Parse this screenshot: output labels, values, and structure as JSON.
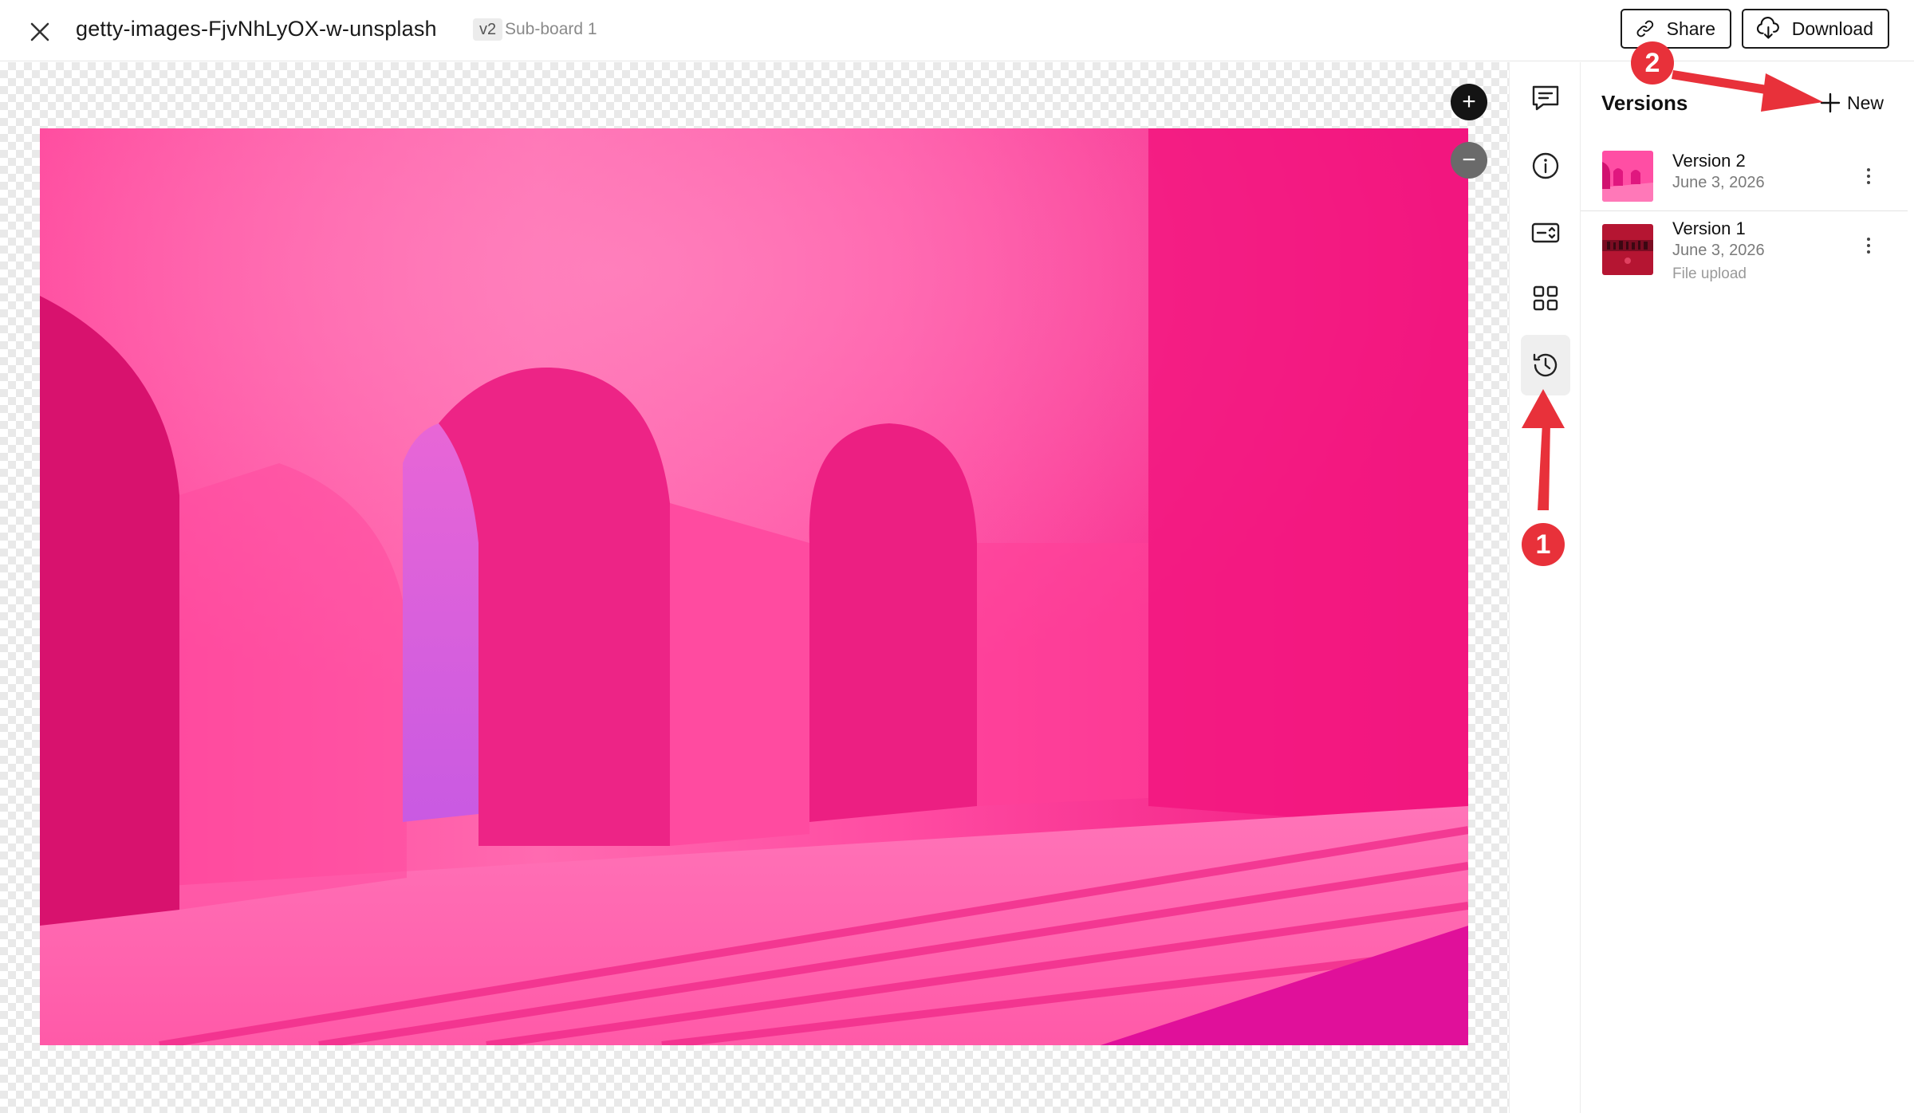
{
  "header": {
    "file_name": "getty-images-FjvNhLyOX-w-unsplash",
    "version_tag": "v2",
    "board_name": "Sub-board 1",
    "share_label": "Share",
    "download_label": "Download"
  },
  "canvas": {
    "zoom_in_label": "+",
    "zoom_out_label": "−"
  },
  "rail": {
    "items": [
      "comments",
      "info",
      "fields",
      "grid",
      "version-history"
    ],
    "active_item": "version-history"
  },
  "versions_panel": {
    "title": "Versions",
    "new_label": "New",
    "items": [
      {
        "name": "Version 2",
        "date": "June 3, 2026",
        "note": ""
      },
      {
        "name": "Version 1",
        "date": "June 3, 2026",
        "note": "File upload"
      }
    ]
  },
  "annotations": {
    "step1": "1",
    "step2": "2",
    "color": "#e8313a"
  },
  "colors": {
    "accent_pink": "#ff2f92",
    "annotation_red": "#e8313a"
  }
}
